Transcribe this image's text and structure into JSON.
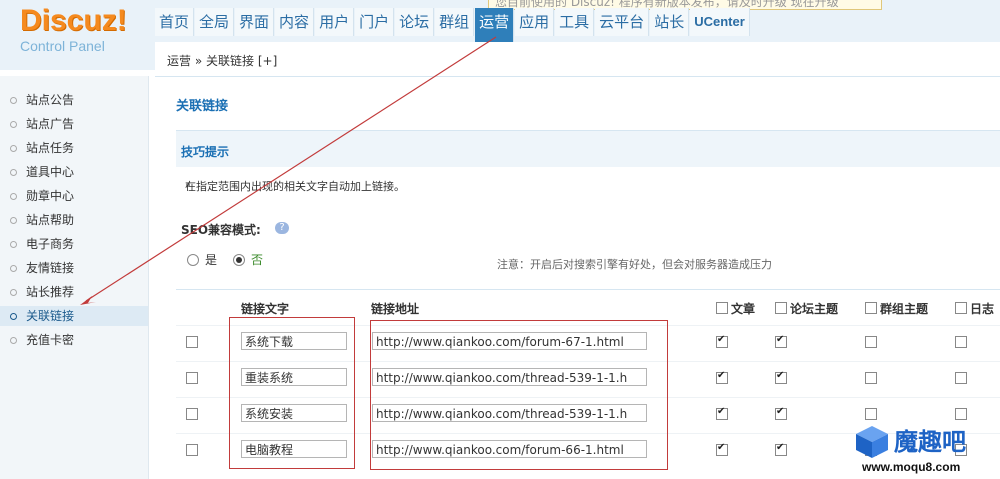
{
  "logo": {
    "main": "Discuz!",
    "sub": "Control Panel"
  },
  "top_tip": "您目前使用的 Discuz! 程序有新版本发布，请及时升级    现在升级",
  "nav": {
    "items": [
      {
        "label": "首页"
      },
      {
        "label": "全局"
      },
      {
        "label": "界面"
      },
      {
        "label": "内容"
      },
      {
        "label": "用户"
      },
      {
        "label": "门户"
      },
      {
        "label": "论坛"
      },
      {
        "label": "群组"
      },
      {
        "label": "运营",
        "active": true
      },
      {
        "label": "应用"
      },
      {
        "label": "工具"
      },
      {
        "label": "云平台"
      },
      {
        "label": "站长"
      },
      {
        "label": "UCenter"
      }
    ]
  },
  "breadcrumb": {
    "section": "运营",
    "sep": "»",
    "page": "关联链接",
    "add": "[+]"
  },
  "sidebar": {
    "items": [
      {
        "label": "站点公告"
      },
      {
        "label": "站点广告"
      },
      {
        "label": "站点任务"
      },
      {
        "label": "道具中心"
      },
      {
        "label": "勋章中心"
      },
      {
        "label": "站点帮助"
      },
      {
        "label": "电子商务"
      },
      {
        "label": "友情链接"
      },
      {
        "label": "站长推荐"
      },
      {
        "label": "关联链接",
        "active": true
      },
      {
        "label": "充值卡密"
      }
    ]
  },
  "main": {
    "title": "关联链接",
    "hint_title": "技巧提示",
    "hint_text": "在指定范围内出现的相关文字自动加上链接。",
    "seo_label": "SEO兼容模式:",
    "seo_help": "?",
    "seo_options": [
      "是",
      "否"
    ],
    "seo_selected": "否",
    "seo_note": "注意：开启后对搜索引擎有好处，但会对服务器造成压力",
    "columns": [
      "链接文字",
      "链接地址",
      "文章",
      "论坛主题",
      "群组主题",
      "日志"
    ],
    "rows": [
      {
        "text": "系统下载",
        "url": "http://www.qiankoo.com/forum-67-1.html",
        "article": true,
        "thread": true,
        "group": false,
        "blog": false
      },
      {
        "text": "重装系统",
        "url": "http://www.qiankoo.com/thread-539-1-1.h",
        "article": true,
        "thread": true,
        "group": false,
        "blog": false
      },
      {
        "text": "系统安装",
        "url": "http://www.qiankoo.com/thread-539-1-1.h",
        "article": true,
        "thread": true,
        "group": false,
        "blog": false
      },
      {
        "text": "电脑教程",
        "url": "http://www.qiankoo.com/forum-66-1.html",
        "article": true,
        "thread": true,
        "group": false,
        "blog": false
      }
    ]
  },
  "watermark": {
    "text": "魔趣吧",
    "url": "www.moqu8.com"
  },
  "colors": {
    "accent": "#1b70b4",
    "logo": "#f58a1f",
    "annotation": "#c23b3b"
  }
}
